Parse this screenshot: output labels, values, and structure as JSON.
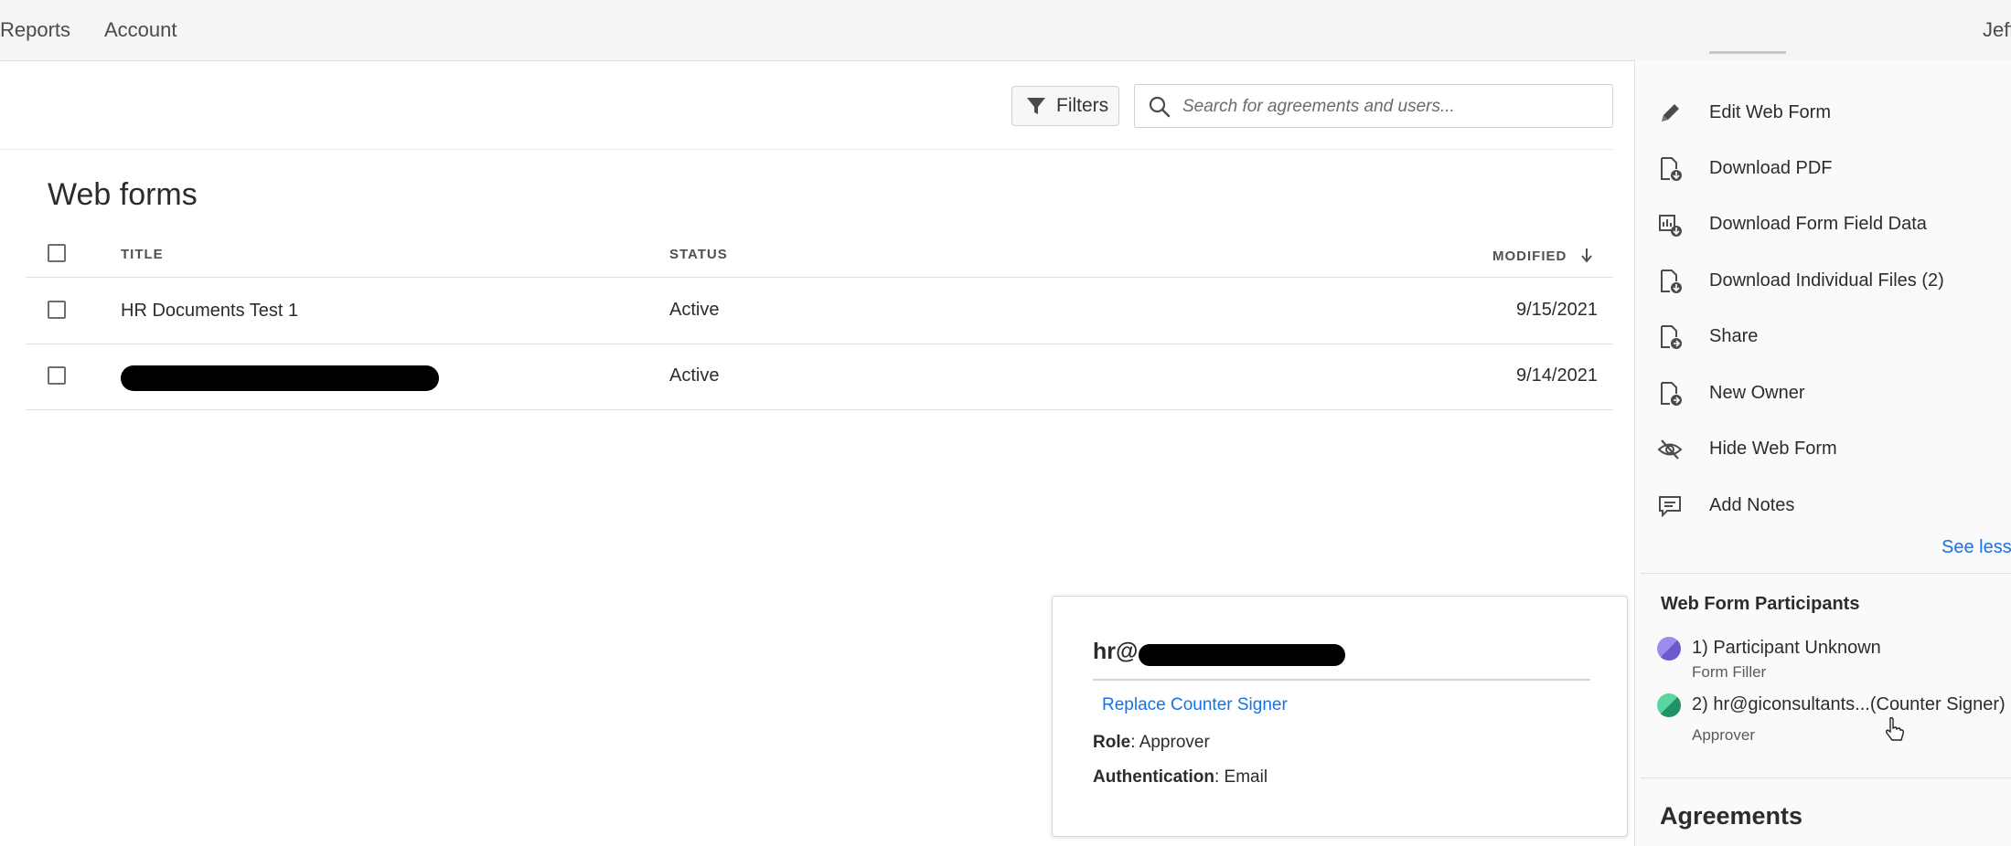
{
  "topnav": {
    "links": [
      "Reports",
      "Account"
    ],
    "user": "Jeff"
  },
  "toolbar": {
    "filters_label": "Filters",
    "search_placeholder": "Search for agreements and users..."
  },
  "list": {
    "title": "Web forms",
    "columns": {
      "title": "TITLE",
      "status": "STATUS",
      "modified": "MODIFIED"
    },
    "rows": [
      {
        "title": "HR Documents Test 1",
        "status": "Active",
        "modified": "9/15/2021"
      },
      {
        "title": "",
        "status": "Active",
        "modified": "9/14/2021"
      }
    ]
  },
  "panel": {
    "actions": [
      {
        "label": "Edit Web Form",
        "icon": "pencil-icon"
      },
      {
        "label": "Download PDF",
        "icon": "download-pdf-icon"
      },
      {
        "label": "Download Form Field Data",
        "icon": "download-data-icon"
      },
      {
        "label": "Download Individual Files (2)",
        "icon": "download-files-icon"
      },
      {
        "label": "Share",
        "icon": "share-icon"
      },
      {
        "label": "New Owner",
        "icon": "new-owner-icon"
      },
      {
        "label": "Hide Web Form",
        "icon": "eye-hidden-icon"
      },
      {
        "label": "Add Notes",
        "icon": "notes-icon"
      }
    ],
    "see_less": "See less",
    "participants_heading": "Web Form Participants",
    "participants": [
      {
        "name": "1) Participant Unknown",
        "role": "Form Filler",
        "color": "#7b6fdc"
      },
      {
        "name": "2) hr@giconsultants...(Counter Signer)",
        "role": "Approver",
        "color": "#2aa876"
      }
    ],
    "agreements_heading": "Agreements"
  },
  "popover": {
    "email_prefix": "hr@",
    "replace_label": "Replace Counter Signer",
    "role_label": "Role",
    "role_value": ": Approver",
    "auth_label": "Authentication",
    "auth_value": ": Email"
  }
}
